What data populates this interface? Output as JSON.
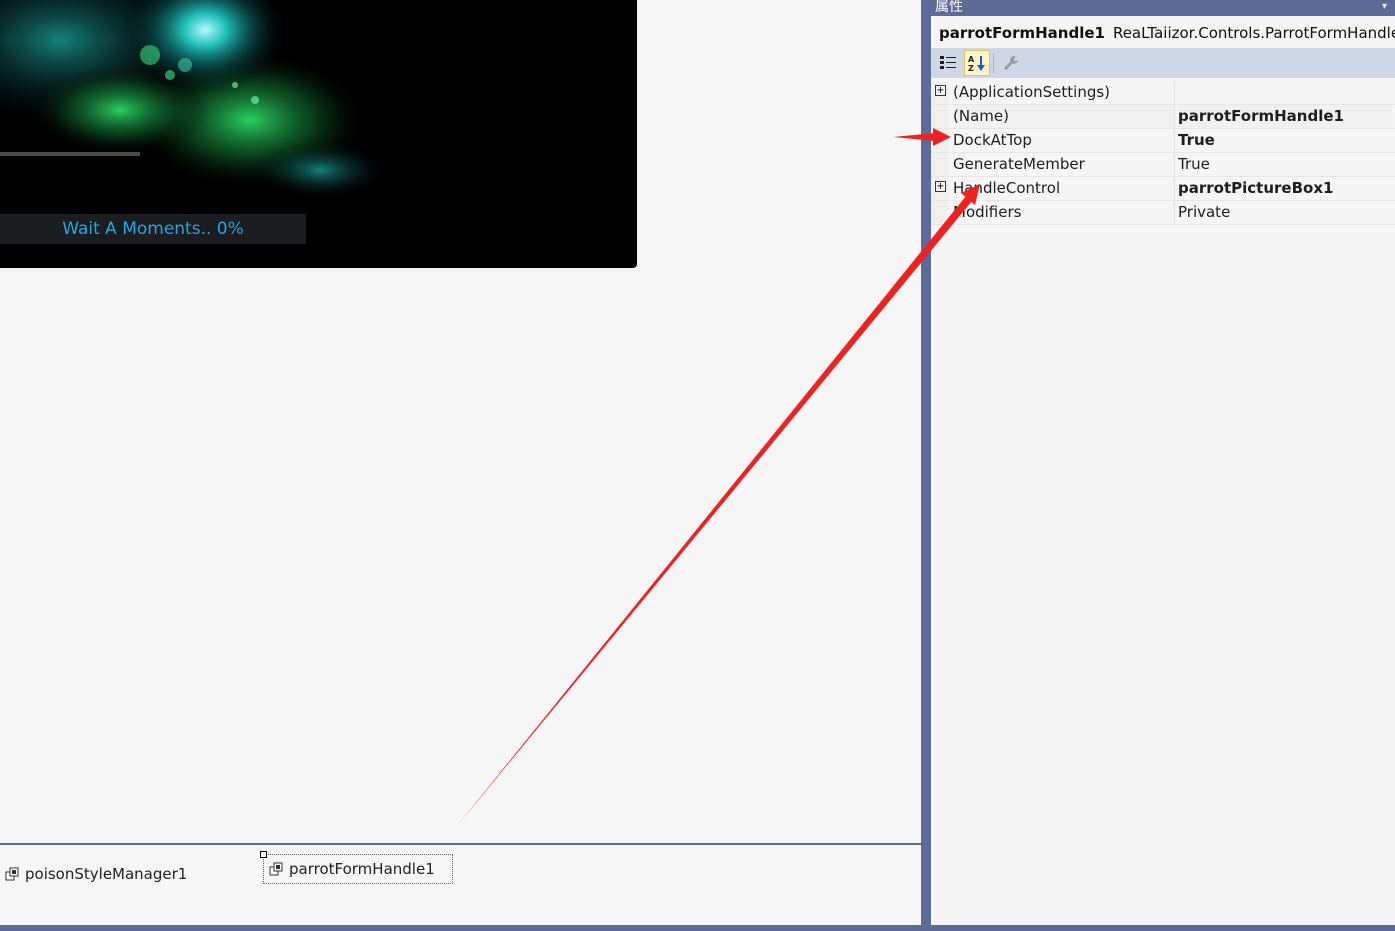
{
  "designer": {
    "splash": {
      "status_text": "Wait A Moments.. 0%",
      "progress_fraction": 0.22
    },
    "tray": {
      "items": [
        {
          "label": "poisonStyleManager1"
        },
        {
          "label": "parrotFormHandle1"
        }
      ]
    }
  },
  "properties": {
    "title": "属性",
    "object": {
      "name": "parrotFormHandle1",
      "type": "ReaLTaiizor.Controls.ParrotFormHandle"
    },
    "toolbar": {
      "categorized_icon": "categorized-icon",
      "alphabetical_icon": "sort-az-icon",
      "pages_icon": "wrench-icon"
    },
    "rows": [
      {
        "name": "(ApplicationSettings)",
        "value": "",
        "expandable": true
      },
      {
        "name": "(Name)",
        "value": "parrotFormHandle1",
        "bold": true
      },
      {
        "name": "DockAtTop",
        "value": "True",
        "bold": true
      },
      {
        "name": "GenerateMember",
        "value": "True"
      },
      {
        "name": "HandleControl",
        "value": "parrotPictureBox1",
        "bold": true,
        "expandable": true
      },
      {
        "name": "Modifiers",
        "value": "Private"
      }
    ]
  },
  "colors": {
    "frame": "#5d6b99",
    "status_text": "#20a8e0",
    "annotation": "#ee2222"
  }
}
